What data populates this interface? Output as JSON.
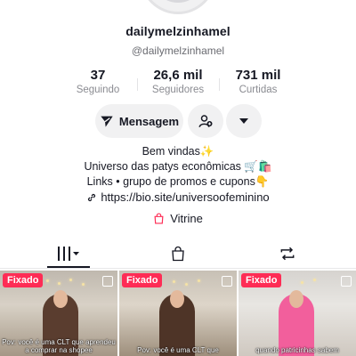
{
  "profile": {
    "username": "dailymelzinhamel",
    "handle": "@dailymelzinhamel"
  },
  "stats": [
    {
      "value": "37",
      "label": "Seguindo"
    },
    {
      "value": "26,6 mil",
      "label": "Seguidores"
    },
    {
      "value": "731 mil",
      "label": "Curtidas"
    }
  ],
  "actions": {
    "message_label": "Mensagem"
  },
  "bio": {
    "line1": "Bem vindas✨",
    "line2": "Universo das patys econômicas 🛒🛍️",
    "line3": "Links • grupo de promos e cupons👇",
    "link": "https://bio.site/universoofeminino"
  },
  "vitrine": {
    "label": "Vitrine"
  },
  "tabs": [
    "videos-grid",
    "purchases",
    "reposts"
  ],
  "videos": [
    {
      "pinned_label": "Fixado",
      "caption": "Pov: você é uma CLT que aprendeu a comprar na shopee"
    },
    {
      "pinned_label": "Fixado",
      "caption": "Pov: você é uma CLT que"
    },
    {
      "pinned_label": "Fixado",
      "caption": "quando patricinhas sabem"
    }
  ],
  "colors": {
    "accent": "#fe2c55",
    "text": "#161823",
    "muted": "#8a8b91",
    "button_bg": "#f1f1f2"
  }
}
